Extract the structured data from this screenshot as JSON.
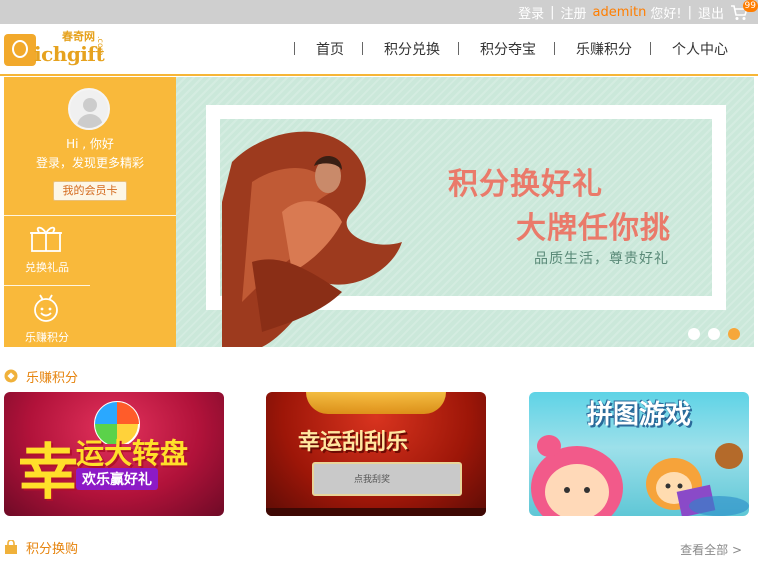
{
  "topbar": {
    "login": "登录",
    "register": "注册",
    "username": "ademitn",
    "hello": "您好!",
    "logout": "退出",
    "cart_count": "99"
  },
  "logo": {
    "text": "ichgift",
    "cn": "春奇网",
    "com": ".com"
  },
  "nav": [
    "首页",
    "积分兑换",
    "积分夺宝",
    "乐赚积分",
    "个人中心"
  ],
  "sidebar": {
    "greeting": "Hi , 你好",
    "login_link": "登录",
    "promo": "，发现更多精彩",
    "member_card": "我的会员卡",
    "items": [
      {
        "label": "兑换礼品",
        "icon": "gift-icon"
      },
      {
        "label": "乐赚积分",
        "icon": "smile-icon"
      }
    ]
  },
  "banner": {
    "title_line1": "积分换好礼",
    "title_line2": "大牌任你挑",
    "subtitle": "品质生活，尊贵好礼",
    "slides": 3,
    "active_slide": 3
  },
  "sections": {
    "earn": {
      "title": "乐赚积分"
    },
    "exchange": {
      "title": "积分换购",
      "more": "查看全部 >"
    }
  },
  "games": [
    {
      "title_a": "幸",
      "title_b": "运大转盘",
      "sub": "欢乐赢好礼"
    },
    {
      "title": "幸运刮刮乐",
      "sub": "点我刮奖"
    },
    {
      "title": "拼图游戏"
    }
  ],
  "colors": {
    "accent": "#f9b93b",
    "orange": "#ff7e00",
    "banner_text": "#ea7a6a"
  }
}
